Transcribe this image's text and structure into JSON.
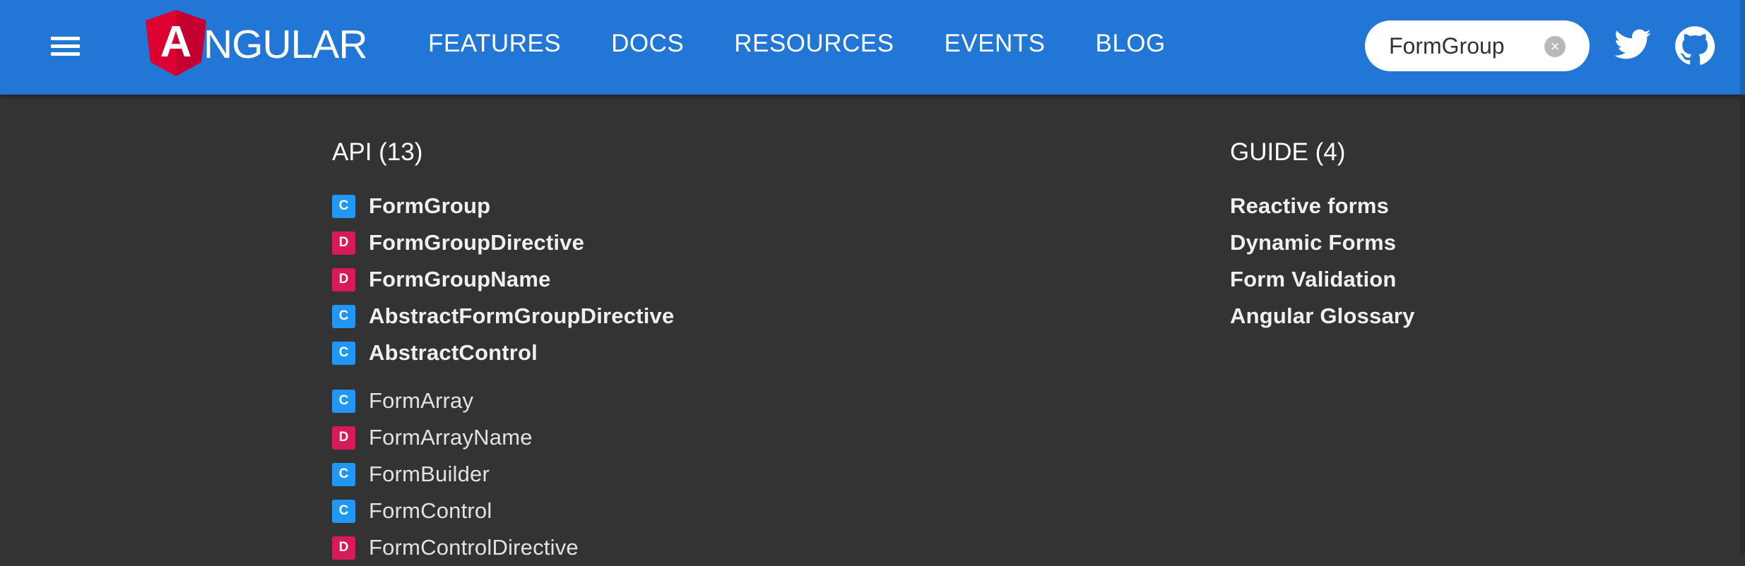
{
  "header": {
    "brand": "NGULAR",
    "brand_logo_letter": "A",
    "nav": [
      "FEATURES",
      "DOCS",
      "RESOURCES",
      "EVENTS",
      "BLOG"
    ],
    "search_value": "FormGroup",
    "icons": {
      "menu": "hamburger-menu-icon",
      "clear": "clear-circle-icon",
      "twitter": "twitter-icon",
      "github": "github-icon"
    }
  },
  "colors": {
    "toolbar": "#2277d6",
    "background": "#333333",
    "badge_class": "#2196f3",
    "badge_directive": "#d61a5a",
    "angular_red": "#dd0031"
  },
  "results": {
    "api": {
      "title": "API (13)",
      "items": [
        {
          "badge": "C",
          "label": "FormGroup",
          "priority": true
        },
        {
          "badge": "D",
          "label": "FormGroupDirective",
          "priority": true
        },
        {
          "badge": "D",
          "label": "FormGroupName",
          "priority": true
        },
        {
          "badge": "C",
          "label": "AbstractFormGroupDirective",
          "priority": true
        },
        {
          "badge": "C",
          "label": "AbstractControl",
          "priority": true
        },
        {
          "badge": "C",
          "label": "FormArray",
          "priority": false
        },
        {
          "badge": "D",
          "label": "FormArrayName",
          "priority": false
        },
        {
          "badge": "C",
          "label": "FormBuilder",
          "priority": false
        },
        {
          "badge": "C",
          "label": "FormControl",
          "priority": false
        },
        {
          "badge": "D",
          "label": "FormControlDirective",
          "priority": false
        }
      ]
    },
    "guide": {
      "title": "GUIDE (4)",
      "items": [
        {
          "label": "Reactive forms"
        },
        {
          "label": "Dynamic Forms"
        },
        {
          "label": "Form Validation"
        },
        {
          "label": "Angular Glossary"
        }
      ]
    }
  }
}
